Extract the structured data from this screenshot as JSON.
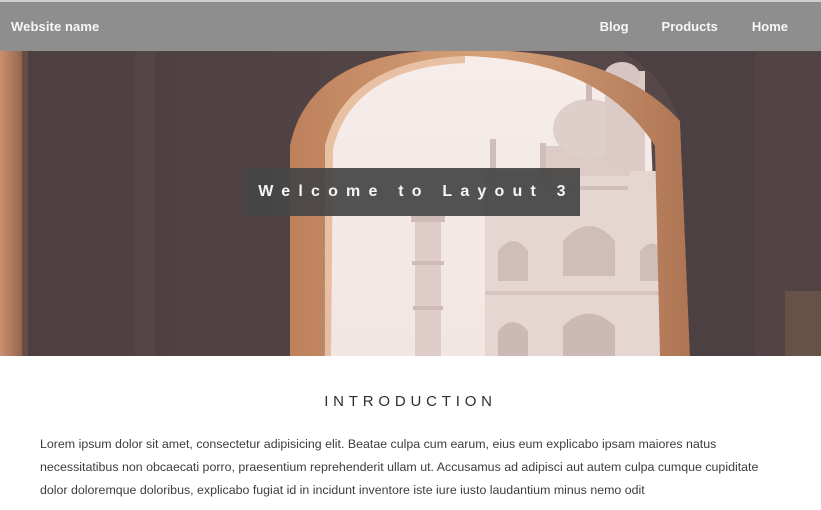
{
  "nav": {
    "brand": "Website name",
    "links": [
      "Blog",
      "Products",
      "Home"
    ]
  },
  "hero": {
    "title": "Welcome to Layout 3"
  },
  "intro": {
    "heading": "INTRODUCTION",
    "body": "Lorem ipsum dolor sit amet, consectetur adipisicing elit. Beatae culpa cum earum, eius eum explicabo ipsam maiores natus necessitatibus non obcaecati porro, praesentium reprehenderit ullam ut. Accusamus ad adipisci aut autem culpa cumque cupiditate dolor doloremque doloribus, explicabo fugiat id in incidunt inventore iste iure iusto laudantium minus nemo odit"
  },
  "colors": {
    "navbar": "#8e8e8e",
    "nav_text": "#f7f7f7",
    "title_box": "#464646"
  }
}
